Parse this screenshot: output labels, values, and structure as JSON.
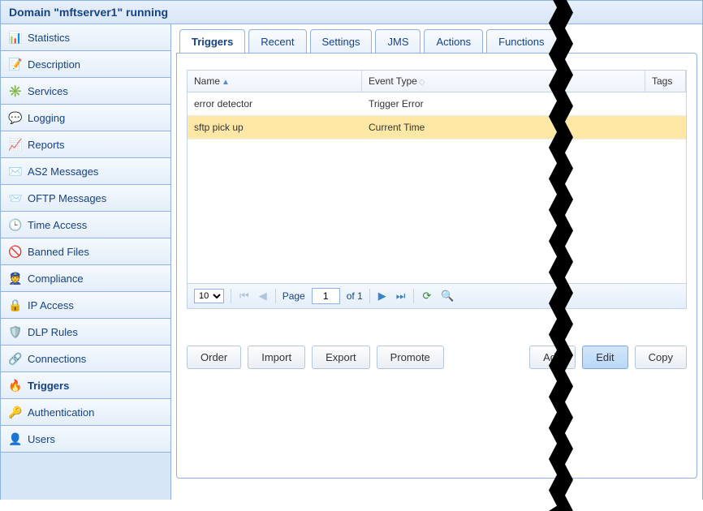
{
  "header": {
    "title": "Domain \"mftserver1\" running"
  },
  "sidebar": {
    "items": [
      {
        "label": "Statistics",
        "icon": "📊"
      },
      {
        "label": "Description",
        "icon": "📝"
      },
      {
        "label": "Services",
        "icon": "✳️"
      },
      {
        "label": "Logging",
        "icon": "💬"
      },
      {
        "label": "Reports",
        "icon": "📈"
      },
      {
        "label": "AS2 Messages",
        "icon": "✉️"
      },
      {
        "label": "OFTP Messages",
        "icon": "📨"
      },
      {
        "label": "Time Access",
        "icon": "🕒"
      },
      {
        "label": "Banned Files",
        "icon": "🚫"
      },
      {
        "label": "Compliance",
        "icon": "👮"
      },
      {
        "label": "IP Access",
        "icon": "🔒"
      },
      {
        "label": "DLP Rules",
        "icon": "🛡️"
      },
      {
        "label": "Connections",
        "icon": "🔗"
      },
      {
        "label": "Triggers",
        "icon": "🔥",
        "active": true
      },
      {
        "label": "Authentication",
        "icon": "🔑"
      },
      {
        "label": "Users",
        "icon": "👤"
      }
    ]
  },
  "tabs": [
    {
      "label": "Triggers",
      "active": true
    },
    {
      "label": "Recent"
    },
    {
      "label": "Settings"
    },
    {
      "label": "JMS"
    },
    {
      "label": "Actions"
    },
    {
      "label": "Functions"
    }
  ],
  "grid": {
    "columns": {
      "name": "Name",
      "event_type": "Event Type",
      "tags": "Tags"
    },
    "rows": [
      {
        "name": "error detector",
        "event_type": "Trigger Error",
        "tags": "",
        "selected": false
      },
      {
        "name": "sftp pick up",
        "event_type": "Current Time",
        "tags": "",
        "selected": true
      }
    ]
  },
  "paging": {
    "page_size": "10",
    "page_label": "Page",
    "current_page": "1",
    "of_label": "of 1"
  },
  "buttons": {
    "order": "Order",
    "import": "Import",
    "export": "Export",
    "promote": "Promote",
    "add": "Add",
    "edit": "Edit",
    "copy": "Copy"
  }
}
